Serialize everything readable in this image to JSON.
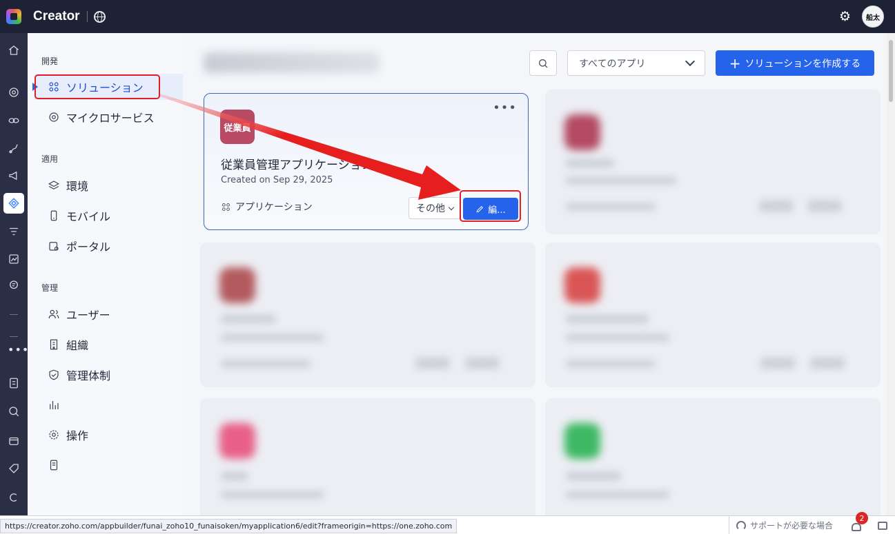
{
  "topbar": {
    "app_title": "Creator",
    "avatar_text": "船太"
  },
  "sidebar": {
    "sections": [
      {
        "heading": "開発",
        "items": [
          {
            "label": "ソリューション",
            "icon": "apps-grid-icon",
            "active": true
          },
          {
            "label": "マイクロサービス",
            "icon": "microservice-icon"
          }
        ]
      },
      {
        "heading": "適用",
        "items": [
          {
            "label": "環境",
            "icon": "layers-icon"
          },
          {
            "label": "モバイル",
            "icon": "mobile-icon"
          },
          {
            "label": "ポータル",
            "icon": "portal-icon"
          }
        ]
      },
      {
        "heading": "管理",
        "items": [
          {
            "label": "ユーザー",
            "icon": "users-icon"
          },
          {
            "label": "組織",
            "icon": "building-icon"
          },
          {
            "label": "管理体制",
            "icon": "shield-icon"
          },
          {
            "label": "",
            "icon": "bar-chart-icon"
          },
          {
            "label": "操作",
            "icon": "gear-icon"
          },
          {
            "label": "",
            "icon": "document-icon"
          }
        ]
      }
    ]
  },
  "toolbar": {
    "filter_value": "すべてのアプリ",
    "create_label": "ソリューションを作成する",
    "create_icon": "plus-icon"
  },
  "card": {
    "badge_text": "従業員",
    "badge_color": "#b94a63",
    "title": "従業員管理アプリケーション",
    "created": "Created on Sep 29, 2025",
    "type_label": "アプリケーション",
    "other_label": "その他",
    "edit_label": "編..."
  },
  "statusbar": {
    "url": "https://creator.zoho.com/appbuilder/funai_zoho10_funaisoken/myapplication6/edit?frameorigin=https://one.zoho.com",
    "support_label": "サポートが必要な場合",
    "notification_count": "2"
  },
  "colors": {
    "topbar": "#1e2235",
    "rail": "#2a2f45",
    "accent": "#2563eb",
    "annotation_red": "#e11d2b"
  }
}
